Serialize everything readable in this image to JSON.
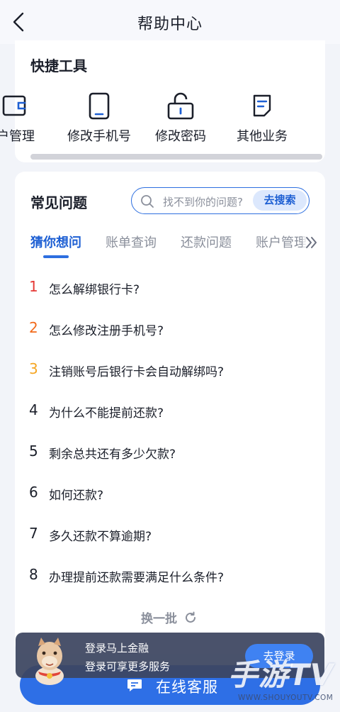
{
  "header": {
    "title": "帮助中心",
    "back_icon": "chevron-left-icon"
  },
  "quick_tools": {
    "heading": "快捷工具",
    "items": [
      {
        "label": "户管理",
        "icon": "account-card-icon"
      },
      {
        "label": "修改手机号",
        "icon": "phone-icon"
      },
      {
        "label": "修改密码",
        "icon": "lock-icon"
      },
      {
        "label": "其他业务",
        "icon": "document-icon"
      }
    ]
  },
  "faq": {
    "heading": "常见问题",
    "search": {
      "placeholder": "找不到你的问题?",
      "button": "去搜索",
      "icon": "search-icon"
    },
    "tabs": [
      {
        "label": "猜你想问",
        "active": true
      },
      {
        "label": "账单查询",
        "active": false
      },
      {
        "label": "还款问题",
        "active": false
      },
      {
        "label": "账户管理",
        "active": false
      }
    ],
    "more_icon": "double-chevron-right-icon",
    "questions": [
      {
        "num": "1",
        "text": "怎么解绑银行卡?",
        "color": "#e53935"
      },
      {
        "num": "2",
        "text": "怎么修改注册手机号?",
        "color": "#f26a1b"
      },
      {
        "num": "3",
        "text": "注销账号后银行卡会自动解绑吗?",
        "color": "#f5a623"
      },
      {
        "num": "4",
        "text": "为什么不能提前还款?",
        "color": "#1b1f2a"
      },
      {
        "num": "5",
        "text": "剩余总共还有多少欠款?",
        "color": "#1b1f2a"
      },
      {
        "num": "6",
        "text": "如何还款?",
        "color": "#1b1f2a"
      },
      {
        "num": "7",
        "text": "多久还款不算逾期?",
        "color": "#1b1f2a"
      },
      {
        "num": "8",
        "text": "办理提前还款需要满足什么条件?",
        "color": "#1b1f2a"
      }
    ],
    "refresh_label": "换一批",
    "refresh_icon": "refresh-icon"
  },
  "service_button": {
    "label": "在线客服",
    "icon": "chat-icon"
  },
  "login_banner": {
    "line1": "登录马上金融",
    "line2": "登录可享更多服务",
    "button": "去登录"
  },
  "watermark": {
    "big": "手游TV",
    "small": "WWW.SHOUYOUTV.COM"
  },
  "colors": {
    "accent": "#2e6fe6",
    "background": "#f2f4f9"
  }
}
